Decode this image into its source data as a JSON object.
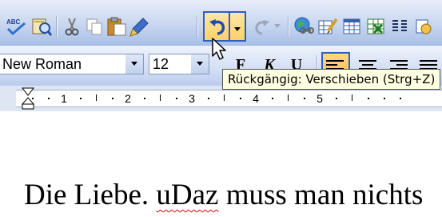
{
  "toolbar": {
    "undo_tooltip": "Rückgängig: Verschieben (Strg+Z)",
    "icons": [
      "spellcheck-icon",
      "research-icon",
      "cut-icon",
      "copy-icon",
      "paste-icon",
      "format-painter-icon",
      "undo-icon",
      "redo-icon",
      "hyperlink-icon",
      "tables-borders-icon",
      "insert-table-icon",
      "insert-excel-icon",
      "columns-icon"
    ]
  },
  "format": {
    "font_name": "New Roman",
    "font_size": "12",
    "bold_label": "F",
    "italic_label": "K",
    "underline_label": "U"
  },
  "ruler": {
    "numbers": [
      "1",
      "2",
      "3",
      "4",
      "5"
    ]
  },
  "document": {
    "text_before": "Die Liebe. ",
    "misspelled_word": "uDaz",
    "text_after": " muss man nichts"
  },
  "colors": {
    "accent": "#2c5fbf",
    "active_button": "#ffd06a",
    "tooltip_bg": "#ffffe1",
    "spell_error": "#e00000"
  }
}
